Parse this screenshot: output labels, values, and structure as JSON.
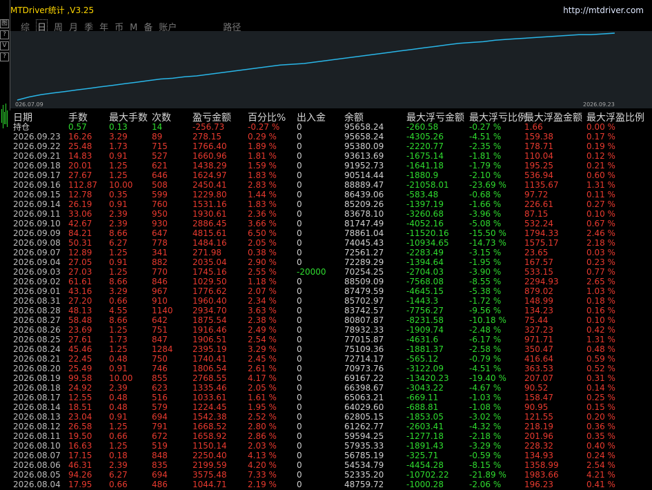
{
  "window": {
    "title": "MTDriver统计 ,V3.25",
    "url": "http://mtdriver.com"
  },
  "left_buttons": [
    "图",
    "?",
    "V",
    "?"
  ],
  "tabs": [
    {
      "label": "综",
      "active": false
    },
    {
      "label": "日",
      "active": true
    },
    {
      "label": "周",
      "active": false
    },
    {
      "label": "月",
      "active": false
    },
    {
      "label": "季",
      "active": false
    },
    {
      "label": "年",
      "active": false
    },
    {
      "label": "币",
      "active": false
    },
    {
      "label": "M",
      "active": false
    },
    {
      "label": "备",
      "active": false
    },
    {
      "label": "账户",
      "active": false
    },
    {
      "label": "路径",
      "active": false
    }
  ],
  "equity_chart": {
    "start_label": "026.07.09",
    "end_label": "2026.09.23",
    "line_color": "#29b6e8",
    "points": [
      0,
      4,
      7,
      9,
      11,
      13,
      15,
      17,
      19,
      21,
      23,
      25,
      27,
      28,
      30,
      31,
      33,
      35,
      37,
      39,
      41,
      43,
      45,
      46,
      47,
      49,
      51,
      53,
      55,
      57,
      59,
      61,
      63,
      65,
      67,
      69,
      71,
      73,
      74,
      75,
      77,
      78,
      79,
      80,
      81,
      82,
      83,
      84,
      84,
      85,
      86
    ]
  },
  "columns": [
    "日期",
    "手数",
    "最大手数",
    "次数",
    "盈亏金额",
    "百分比%",
    "出入金",
    "余额",
    "最大浮亏金额",
    "最大浮亏比例",
    "最大浮盈金额",
    "最大浮盈比例"
  ],
  "holding_row": {
    "date": "持仓",
    "lots": "0.57",
    "max_lots": "0.13",
    "count": "14",
    "pnl": "-256.73",
    "pct": "-0.27 %",
    "io": "0",
    "balance": "95658.24",
    "max_dd": "-260.58",
    "max_dd_pct": "-0.27 %",
    "max_up": "1.66",
    "max_up_pct": "0.00 %"
  },
  "rows": [
    [
      "2026.09.23",
      "16.26",
      "3.29",
      "89",
      "278.15",
      "0.29 %",
      "0",
      "95658.24",
      "-4305.26",
      "-4.51 %",
      "159.38",
      "0.17 %"
    ],
    [
      "2026.09.22",
      "25.48",
      "1.73",
      "715",
      "1766.40",
      "1.89 %",
      "0",
      "95380.09",
      "-2220.77",
      "-2.35 %",
      "178.71",
      "0.19 %"
    ],
    [
      "2026.09.21",
      "14.83",
      "0.91",
      "527",
      "1660.96",
      "1.81 %",
      "0",
      "93613.69",
      "-1675.14",
      "-1.81 %",
      "110.04",
      "0.12 %"
    ],
    [
      "2026.09.18",
      "20.01",
      "1.25",
      "621",
      "1438.29",
      "1.59 %",
      "0",
      "91952.73",
      "-1641.18",
      "-1.79 %",
      "195.25",
      "0.21 %"
    ],
    [
      "2026.09.17",
      "27.67",
      "1.25",
      "646",
      "1624.97",
      "1.83 %",
      "0",
      "90514.44",
      "-1880.9",
      "-2.10 %",
      "536.94",
      "0.60 %"
    ],
    [
      "2026.09.16",
      "112.87",
      "10.00",
      "508",
      "2450.41",
      "2.83 %",
      "0",
      "88889.47",
      "-21058.01",
      "-23.69 %",
      "1135.67",
      "1.31 %"
    ],
    [
      "2026.09.15",
      "12.78",
      "0.35",
      "599",
      "1229.80",
      "1.44 %",
      "0",
      "86439.06",
      "-583.48",
      "-0.68 %",
      "97.72",
      "0.11 %"
    ],
    [
      "2026.09.14",
      "26.19",
      "0.91",
      "760",
      "1531.16",
      "1.83 %",
      "0",
      "85209.26",
      "-1397.19",
      "-1.66 %",
      "226.61",
      "0.27 %"
    ],
    [
      "2026.09.11",
      "33.06",
      "2.39",
      "950",
      "1930.61",
      "2.36 %",
      "0",
      "83678.10",
      "-3260.68",
      "-3.96 %",
      "87.15",
      "0.10 %"
    ],
    [
      "2026.09.10",
      "42.67",
      "2.39",
      "930",
      "2886.45",
      "3.66 %",
      "0",
      "81747.49",
      "-4052.16",
      "-5.08 %",
      "532.24",
      "0.67 %"
    ],
    [
      "2026.09.09",
      "84.21",
      "8.66",
      "647",
      "4815.61",
      "6.50 %",
      "0",
      "78861.04",
      "-11520.16",
      "-15.50 %",
      "1794.33",
      "2.46 %"
    ],
    [
      "2026.09.08",
      "50.31",
      "6.27",
      "778",
      "1484.16",
      "2.05 %",
      "0",
      "74045.43",
      "-10934.65",
      "-14.73 %",
      "1575.17",
      "2.18 %"
    ],
    [
      "2026.09.07",
      "12.89",
      "1.25",
      "341",
      "271.98",
      "0.38 %",
      "0",
      "72561.27",
      "-2283.49",
      "-3.15 %",
      "23.65",
      "0.03 %"
    ],
    [
      "2026.09.04",
      "27.05",
      "0.91",
      "882",
      "2035.04",
      "2.90 %",
      "0",
      "72289.29",
      "-1394.64",
      "-1.95 %",
      "167.57",
      "0.23 %"
    ],
    [
      "2026.09.03",
      "27.03",
      "1.25",
      "770",
      "1745.16",
      "2.55 %",
      "-20000",
      "70254.25",
      "-2704.03",
      "-3.90 %",
      "533.15",
      "0.77 %"
    ],
    [
      "2026.09.02",
      "61.61",
      "8.66",
      "846",
      "1029.50",
      "1.18 %",
      "0",
      "88509.09",
      "-7568.08",
      "-8.55 %",
      "2294.93",
      "2.65 %"
    ],
    [
      "2026.09.01",
      "43.16",
      "3.29",
      "967",
      "1776.62",
      "2.07 %",
      "0",
      "87479.59",
      "-4645.15",
      "-5.38 %",
      "879.02",
      "1.03 %"
    ],
    [
      "2026.08.31",
      "27.20",
      "0.66",
      "910",
      "1960.40",
      "2.34 %",
      "0",
      "85702.97",
      "-1443.3",
      "-1.72 %",
      "148.99",
      "0.18 %"
    ],
    [
      "2026.08.28",
      "48.13",
      "4.55",
      "1140",
      "2934.70",
      "3.63 %",
      "0",
      "83742.57",
      "-7756.27",
      "-9.56 %",
      "134.23",
      "0.16 %"
    ],
    [
      "2026.08.27",
      "58.48",
      "8.66",
      "642",
      "1875.54",
      "2.38 %",
      "0",
      "80807.87",
      "-8231.58",
      "-10.18 %",
      "75.44",
      "0.10 %"
    ],
    [
      "2026.08.26",
      "23.69",
      "1.25",
      "751",
      "1916.46",
      "2.49 %",
      "0",
      "78932.33",
      "-1909.74",
      "-2.48 %",
      "327.23",
      "0.42 %"
    ],
    [
      "2026.08.25",
      "27.61",
      "1.73",
      "847",
      "1906.51",
      "2.54 %",
      "0",
      "77015.87",
      "-4631.6",
      "-6.17 %",
      "971.71",
      "1.31 %"
    ],
    [
      "2026.08.24",
      "45.46",
      "1.25",
      "1284",
      "2395.19",
      "3.29 %",
      "0",
      "75109.36",
      "-1881.37",
      "-2.58 %",
      "350.47",
      "0.48 %"
    ],
    [
      "2026.08.21",
      "22.45",
      "0.48",
      "750",
      "1740.41",
      "2.45 %",
      "0",
      "72714.17",
      "-565.12",
      "-0.79 %",
      "416.64",
      "0.59 %"
    ],
    [
      "2026.08.20",
      "25.49",
      "0.91",
      "746",
      "1806.54",
      "2.61 %",
      "0",
      "70973.76",
      "-3122.09",
      "-4.51 %",
      "363.53",
      "0.52 %"
    ],
    [
      "2026.08.19",
      "99.58",
      "10.00",
      "855",
      "2768.55",
      "4.17 %",
      "0",
      "69167.22",
      "-13420.23",
      "-19.40 %",
      "207.07",
      "0.31 %"
    ],
    [
      "2026.08.18",
      "24.92",
      "2.39",
      "623",
      "1335.46",
      "2.05 %",
      "0",
      "66398.67",
      "-3043.22",
      "-4.67 %",
      "90.52",
      "0.14 %"
    ],
    [
      "2026.08.17",
      "12.55",
      "0.48",
      "516",
      "1033.61",
      "1.61 %",
      "0",
      "65063.21",
      "-669.11",
      "-1.03 %",
      "158.47",
      "0.25 %"
    ],
    [
      "2026.08.14",
      "18.51",
      "0.48",
      "579",
      "1224.45",
      "1.95 %",
      "0",
      "64029.60",
      "-688.81",
      "-1.08 %",
      "90.95",
      "0.15 %"
    ],
    [
      "2026.08.13",
      "23.04",
      "0.91",
      "694",
      "1542.38",
      "2.52 %",
      "0",
      "62805.15",
      "-1853.05",
      "-3.02 %",
      "121.55",
      "0.20 %"
    ],
    [
      "2026.08.12",
      "26.58",
      "1.25",
      "791",
      "1668.52",
      "2.80 %",
      "0",
      "61262.77",
      "-2603.41",
      "-4.32 %",
      "218.19",
      "0.36 %"
    ],
    [
      "2026.08.11",
      "19.50",
      "0.66",
      "672",
      "1658.92",
      "2.86 %",
      "0",
      "59594.25",
      "-1277.18",
      "-2.18 %",
      "201.96",
      "0.35 %"
    ],
    [
      "2026.08.10",
      "16.63",
      "1.25",
      "519",
      "1150.14",
      "2.03 %",
      "0",
      "57935.33",
      "-1891.43",
      "-3.29 %",
      "228.32",
      "0.40 %"
    ],
    [
      "2026.08.07",
      "17.15",
      "0.18",
      "848",
      "2250.40",
      "4.13 %",
      "0",
      "56785.19",
      "-325.71",
      "-0.59 %",
      "134.93",
      "0.24 %"
    ],
    [
      "2026.08.06",
      "46.31",
      "2.39",
      "835",
      "2199.59",
      "4.20 %",
      "0",
      "54534.79",
      "-4454.28",
      "-8.15 %",
      "1358.99",
      "2.54 %"
    ],
    [
      "2026.08.05",
      "94.26",
      "6.27",
      "694",
      "3575.48",
      "7.33 %",
      "0",
      "52335.20",
      "-10702.22",
      "-21.89 %",
      "1983.66",
      "4.21 %"
    ],
    [
      "2026.08.04",
      "17.95",
      "0.66",
      "486",
      "1044.71",
      "2.19 %",
      "0",
      "48759.72",
      "-1000.28",
      "-2.06 %",
      "196.23",
      "0.41 %"
    ]
  ]
}
